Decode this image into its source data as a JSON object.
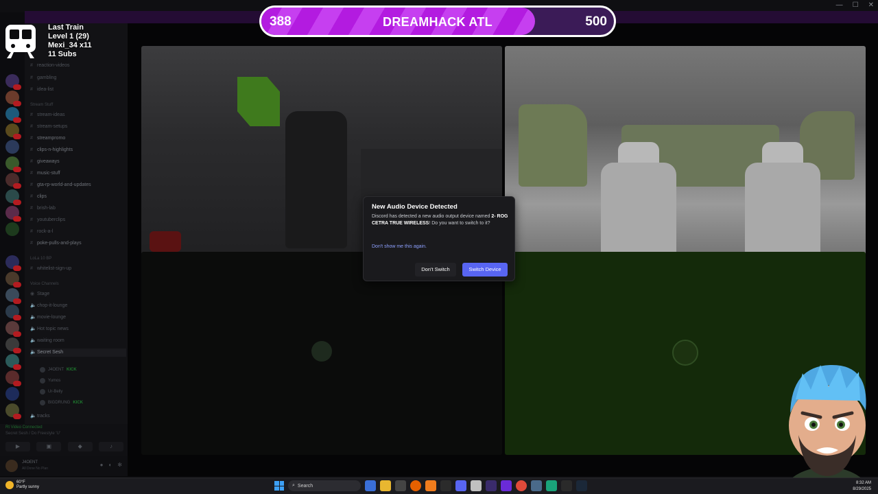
{
  "goal": {
    "current": "388",
    "title": "DREAMHACK ATL",
    "max": "500",
    "progress_fraction": 0.776
  },
  "stats": {
    "lines": [
      "Last Train",
      "Level 1  (29)",
      "Mexi_34 x11",
      "11 Subs"
    ]
  },
  "channels": {
    "items": [
      "reaction-videos",
      "gambling",
      "idea-list",
      "Stream Stuff",
      "stream-ideas",
      "stream-setups",
      "streampromo",
      "clips-n-highlights",
      "giveaways",
      "music-stuff",
      "gta-rp-world-and-updates",
      "clips",
      "brish-lab",
      "youtuberclips",
      "rock-a-l",
      "poke-pulls-and-plays",
      "LoLa 10 BP",
      "whitelist-sign-up",
      "Voice Channels",
      "Stage",
      "chop-it-lounge",
      "movie-lounge",
      "Hot topic news",
      "waiting room",
      "Secret Sesh"
    ],
    "voice_users": [
      "J4OENT",
      "Yumos",
      "Ur-Belly",
      "BIGDRUNG"
    ],
    "kick_label": "KICK",
    "bottom_channel": "tracks",
    "voice_connected": "Rt Video Connected",
    "voice_location": "Secret Sesh / Do Freestyle 'U'",
    "user_name": "J4OENT",
    "user_status": "All Done No Plan"
  },
  "dialog": {
    "title": "New Audio Device Detected",
    "body_prefix": "Discord has detected a new audio output device named ",
    "device": "2- ROG CETRA TRUE WIRELESS",
    "body_suffix": "! Do you want to switch to it?",
    "link": "Don't show me this again.",
    "cancel": "Don't Switch",
    "confirm": "Switch Device"
  },
  "taskbar": {
    "temp": "60°F",
    "condition": "Partly sunny",
    "search": "Search",
    "time": "8:32 AM",
    "date": "8/29/2025"
  },
  "colors": {
    "accent": "#5865f2",
    "goal_fill": "#b31be0",
    "link": "#8ea1ff"
  }
}
